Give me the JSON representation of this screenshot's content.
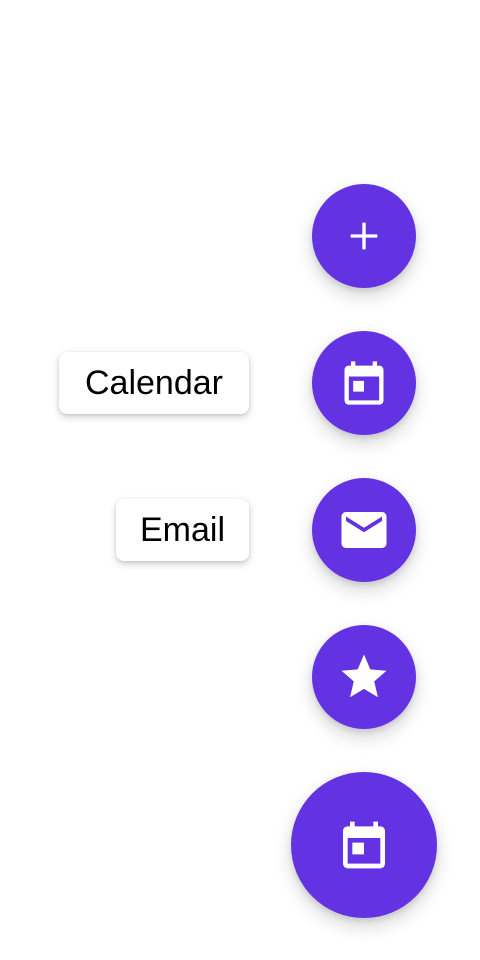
{
  "speed_dial": {
    "actions": [
      {
        "id": "add",
        "label": "",
        "icon": "plus-icon"
      },
      {
        "id": "calendar",
        "label": "Calendar",
        "icon": "calendar-icon"
      },
      {
        "id": "email",
        "label": "Email",
        "icon": "mail-icon"
      },
      {
        "id": "favorite",
        "label": "",
        "icon": "star-icon"
      }
    ],
    "main_fab": {
      "icon": "calendar-icon"
    }
  },
  "colors": {
    "accent": "#6332e3",
    "icon": "#ffffff",
    "label_bg": "#ffffff",
    "label_text": "#000000"
  }
}
